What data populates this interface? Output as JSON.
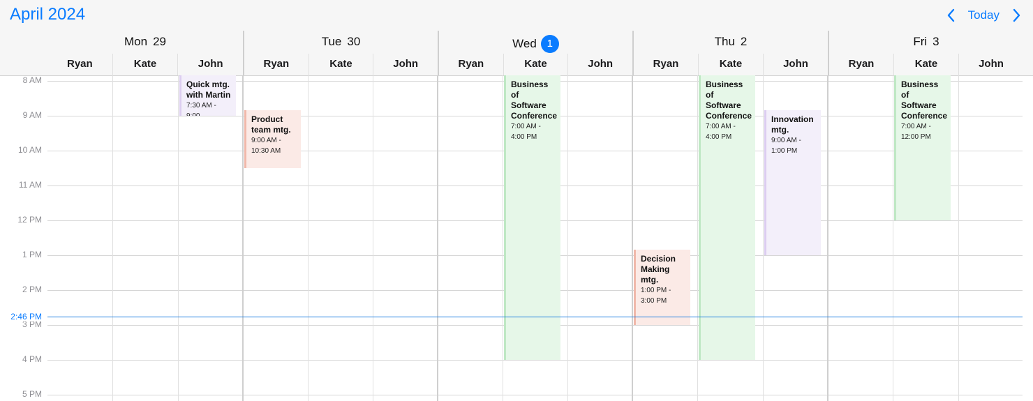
{
  "header": {
    "month_title": "April 2024",
    "today_label": "Today",
    "accent_color": "#0a7cff"
  },
  "days": [
    {
      "weekday": "Mon",
      "date": "29",
      "is_today": false,
      "resources": [
        "Ryan",
        "Kate",
        "John"
      ]
    },
    {
      "weekday": "Tue",
      "date": "30",
      "is_today": false,
      "resources": [
        "Ryan",
        "Kate",
        "John"
      ]
    },
    {
      "weekday": "Wed",
      "date": "1",
      "is_today": true,
      "resources": [
        "Ryan",
        "Kate",
        "John"
      ]
    },
    {
      "weekday": "Thu",
      "date": "2",
      "is_today": false,
      "resources": [
        "Ryan",
        "Kate",
        "John"
      ]
    },
    {
      "weekday": "Fri",
      "date": "3",
      "is_today": false,
      "resources": [
        "Ryan",
        "Kate",
        "John"
      ]
    }
  ],
  "time_labels": [
    "8 AM",
    "9 AM",
    "10 AM",
    "11 AM",
    "12 PM",
    "1 PM",
    "2 PM",
    "3 PM",
    "4 PM",
    "5 PM"
  ],
  "current_time": {
    "label": "2:46 PM"
  },
  "events": [
    {
      "day": 0,
      "resource": 2,
      "title": "Quick mtg. with Martin",
      "time": "7:30 AM - 9:00",
      "color": "purple"
    },
    {
      "day": 1,
      "resource": 0,
      "title": "Product team mtg.",
      "time": "9:00 AM - 10:30 AM",
      "color": "red"
    },
    {
      "day": 2,
      "resource": 1,
      "title": "Business of Software Conference",
      "time": "7:00 AM - 4:00 PM",
      "color": "green"
    },
    {
      "day": 3,
      "resource": 0,
      "title": "Decision Making mtg.",
      "time": "1:00 PM - 3:00 PM",
      "color": "red"
    },
    {
      "day": 3,
      "resource": 1,
      "title": "Business of Software Conference",
      "time": "7:00 AM - 4:00 PM",
      "color": "green"
    },
    {
      "day": 3,
      "resource": 2,
      "title": "Innovation mtg.",
      "time": "9:00 AM - 1:00 PM",
      "color": "purple"
    },
    {
      "day": 4,
      "resource": 1,
      "title": "Business of Software Conference",
      "time": "7:00 AM - 12:00 PM",
      "color": "green"
    }
  ]
}
